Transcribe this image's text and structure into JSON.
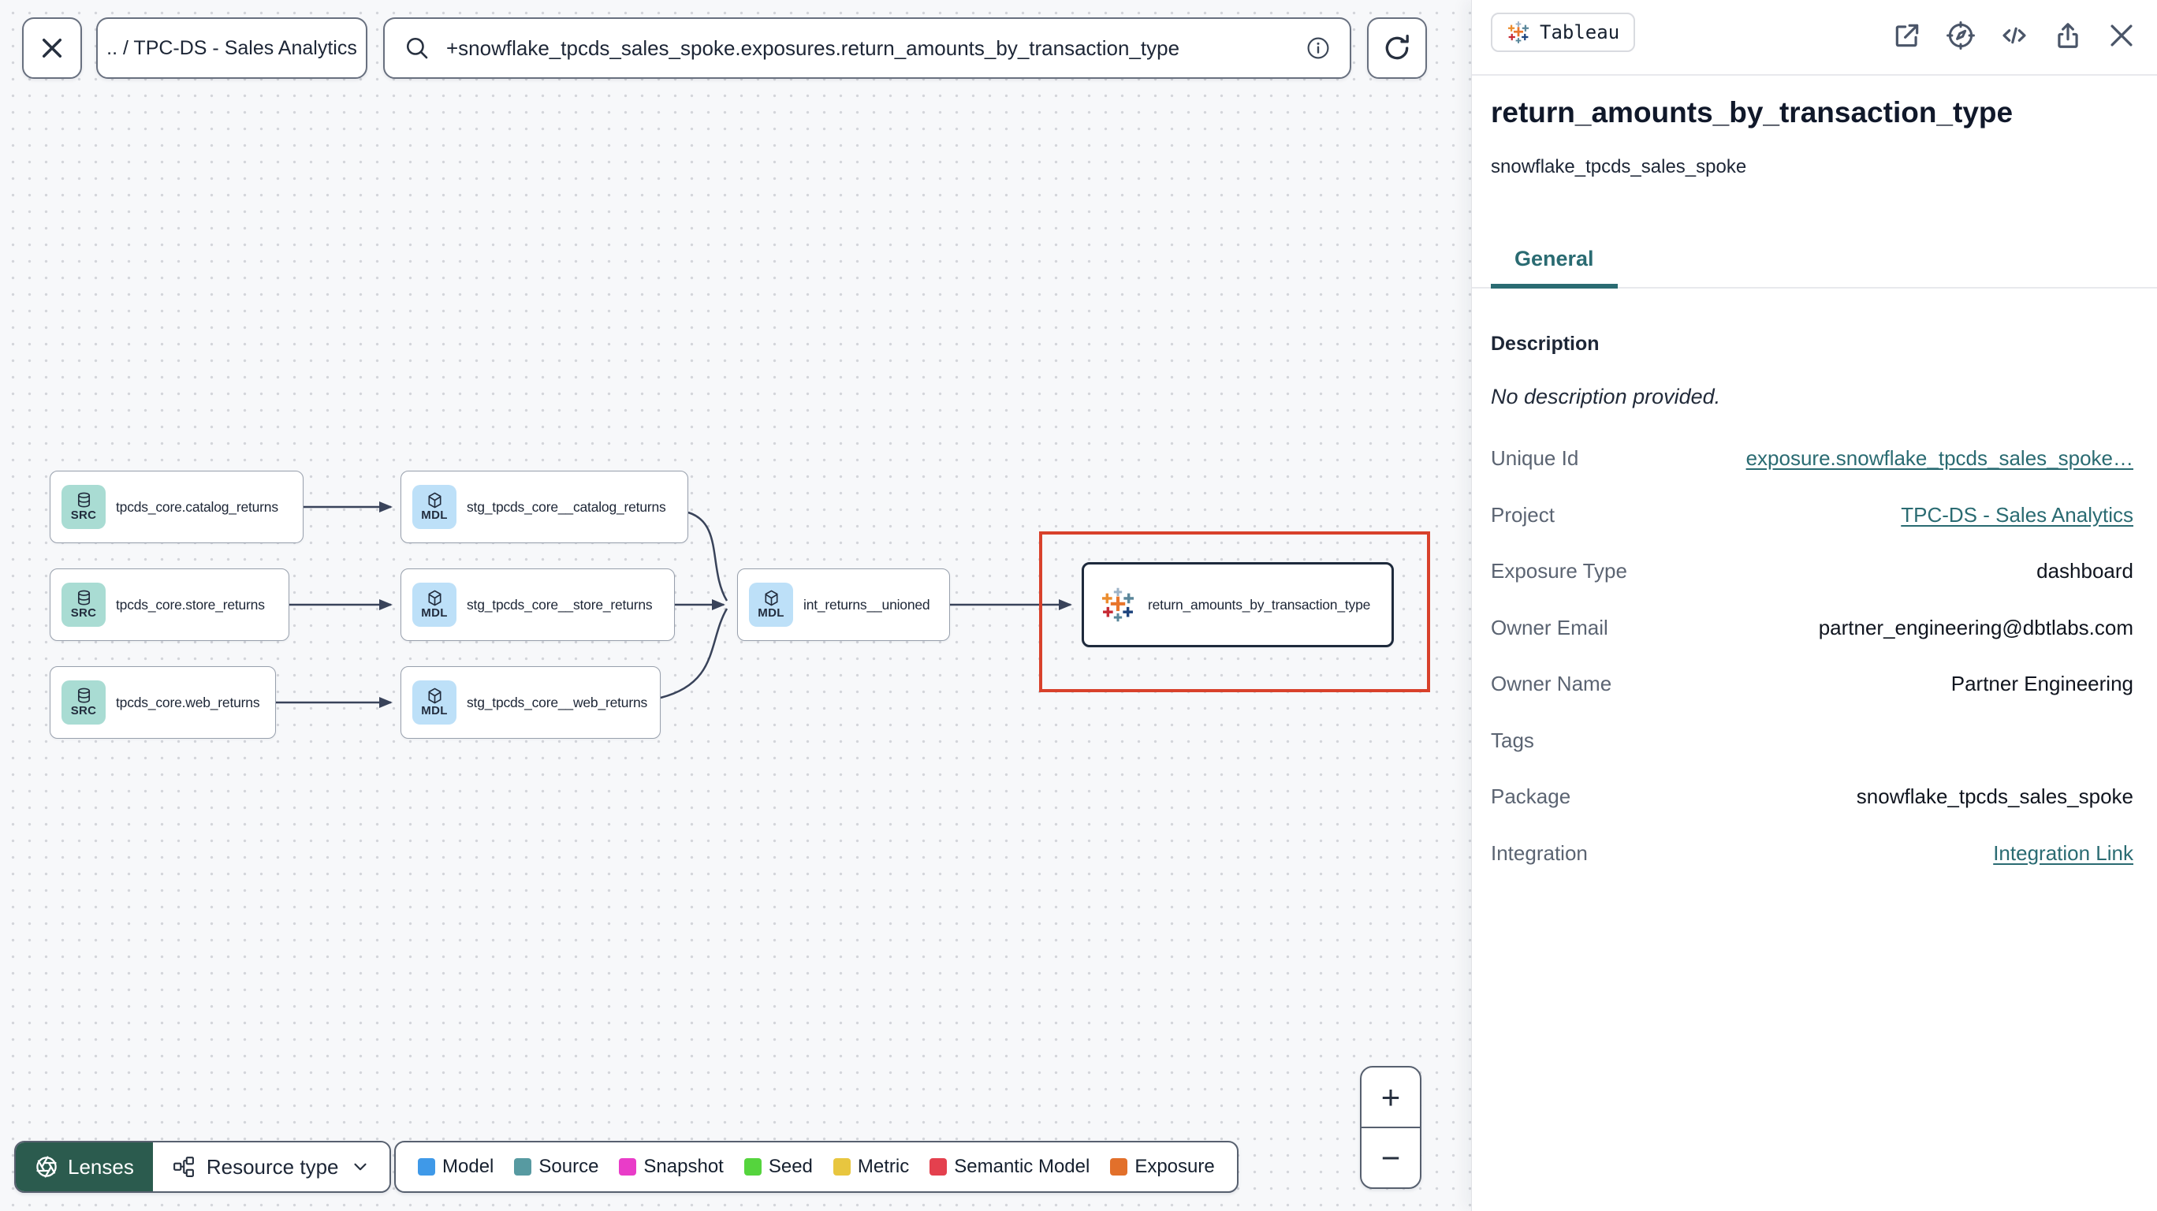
{
  "topbar": {
    "breadcrumb": ".. / TPC-DS - Sales Analytics",
    "search_value": "+snowflake_tpcds_sales_spoke.exposures.return_amounts_by_transaction_type"
  },
  "graph": {
    "nodes": [
      {
        "badge": "SRC",
        "label": "tpcds_core.catalog_returns"
      },
      {
        "badge": "MDL",
        "label": "stg_tpcds_core__catalog_returns"
      },
      {
        "badge": "SRC",
        "label": "tpcds_core.store_returns"
      },
      {
        "badge": "MDL",
        "label": "stg_tpcds_core__store_returns"
      },
      {
        "badge": "SRC",
        "label": "tpcds_core.web_returns"
      },
      {
        "badge": "MDL",
        "label": "stg_tpcds_core__web_returns"
      },
      {
        "badge": "MDL",
        "label": "int_returns__unioned"
      },
      {
        "label": "return_amounts_by_transaction_type"
      }
    ]
  },
  "controls": {
    "lenses_label": "Lenses",
    "resource_type_label": "Resource type",
    "zoom_in": "+",
    "zoom_out": "−"
  },
  "legend": {
    "items": [
      {
        "label": "Model",
        "color": "#3f99e8"
      },
      {
        "label": "Source",
        "color": "#579aa1"
      },
      {
        "label": "Snapshot",
        "color": "#e93cc8"
      },
      {
        "label": "Seed",
        "color": "#55d43d"
      },
      {
        "label": "Metric",
        "color": "#e8c63f"
      },
      {
        "label": "Semantic Model",
        "color": "#e4404e"
      },
      {
        "label": "Exposure",
        "color": "#e2702b"
      }
    ]
  },
  "panel": {
    "badge_label": "Tableau",
    "title": "return_amounts_by_transaction_type",
    "subtitle": "snowflake_tpcds_sales_spoke",
    "tab": "General",
    "description_heading": "Description",
    "description_text": "No description provided.",
    "fields": [
      {
        "label": "Unique Id",
        "value": "exposure.snowflake_tpcds_sales_spoke…"
      },
      {
        "label": "Project",
        "value": "TPC-DS - Sales Analytics"
      },
      {
        "label": "Exposure Type",
        "value": "dashboard"
      },
      {
        "label": "Owner Email",
        "value": "partner_engineering@dbtlabs.com"
      },
      {
        "label": "Owner Name",
        "value": "Partner Engineering"
      },
      {
        "label": "Tags",
        "value": ""
      },
      {
        "label": "Package",
        "value": "snowflake_tpcds_sales_spoke"
      },
      {
        "label": "Integration",
        "value": "Integration Link"
      }
    ]
  },
  "colors": {
    "accent_teal": "#2a6b72",
    "highlight_red": "#d8412b",
    "lenses_green": "#2b5b4e",
    "source_badge": "#a9dcd3",
    "model_badge": "#bde0f8"
  }
}
